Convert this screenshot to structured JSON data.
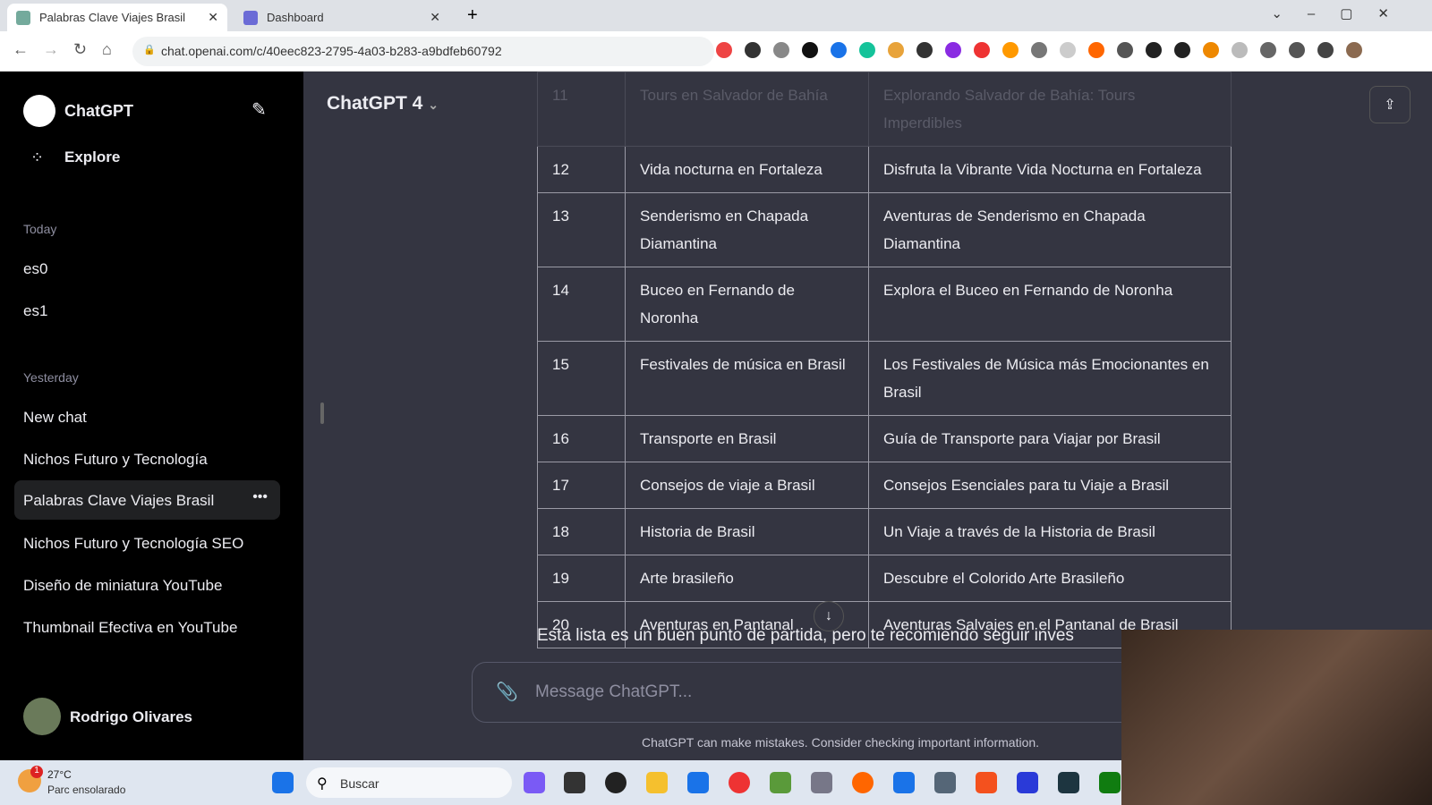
{
  "browser": {
    "tabs": [
      {
        "label": "Palabras Clave Viajes Brasil",
        "active": true
      },
      {
        "label": "Dashboard",
        "active": false
      }
    ],
    "url": "chat.openai.com/c/40eec823-2795-4a03-b283-a9bdfeb60792"
  },
  "sidebar": {
    "app_name": "ChatGPT",
    "explore": "Explore",
    "today_label": "Today",
    "today": [
      "es0",
      "es1"
    ],
    "yesterday_label": "Yesterday",
    "yesterday": [
      "New chat",
      "Nichos Futuro y Tecnología",
      "Palabras Clave Viajes Brasil",
      "Nichos Futuro y Tecnología SEO",
      "Diseño de miniatura YouTube",
      "Thumbnail Efectiva en YouTube"
    ],
    "user": "Rodrigo Olivares"
  },
  "main": {
    "model": "ChatGPT 4",
    "rows": [
      [
        "11",
        "Tours en Salvador de Bahía",
        "Explorando Salvador de Bahía: Tours Imperdibles"
      ],
      [
        "12",
        "Vida nocturna en Fortaleza",
        "Disfruta la Vibrante Vida Nocturna en Fortaleza"
      ],
      [
        "13",
        "Senderismo en Chapada Diamantina",
        "Aventuras de Senderismo en Chapada Diamantina"
      ],
      [
        "14",
        "Buceo en Fernando de Noronha",
        "Explora el Buceo en Fernando de Noronha"
      ],
      [
        "15",
        "Festivales de música en Brasil",
        "Los Festivales de Música más Emocionantes en Brasil"
      ],
      [
        "16",
        "Transporte en Brasil",
        "Guía de Transporte para Viajar por Brasil"
      ],
      [
        "17",
        "Consejos de viaje a Brasil",
        "Consejos Esenciales para tu Viaje a Brasil"
      ],
      [
        "18",
        "Historia de Brasil",
        "Un Viaje a través de la Historia de Brasil"
      ],
      [
        "19",
        "Arte brasileño",
        "Descubre el Colorido Arte Brasileño"
      ],
      [
        "20",
        "Aventuras en Pantanal",
        "Aventuras Salvajes en el Pantanal de Brasil"
      ]
    ],
    "closing_text": "Esta lista es un buen punto de partida, pero te recomiendo seguir inves",
    "input_placeholder": "Message ChatGPT...",
    "disclaimer": "ChatGPT can make mistakes. Consider checking important information."
  },
  "taskbar": {
    "temp": "27°C",
    "weather": "Parc ensolarado",
    "search": "Buscar",
    "badge": "1"
  }
}
